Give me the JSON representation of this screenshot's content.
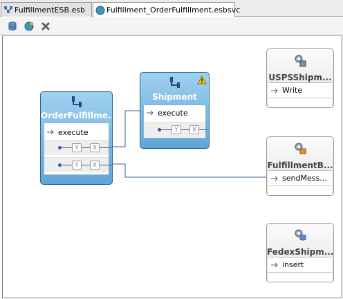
{
  "tabs": [
    {
      "label": "FulfillmentESB.esb",
      "icon": "esb-project-icon",
      "active": false
    },
    {
      "label": "Fulfillment_OrderFulfillment.esbsvc",
      "icon": "globe-icon",
      "active": true
    }
  ],
  "toolbar": {
    "buttons": [
      {
        "icon": "database-icon"
      },
      {
        "icon": "globe-icon"
      },
      {
        "icon": "delete-x-icon"
      }
    ]
  },
  "routers": [
    {
      "title": "OrderFulfillme...",
      "operation": "execute"
    },
    {
      "title": "Shipment",
      "operation": "execute",
      "warning": true
    }
  ],
  "adapters": [
    {
      "title": "USPSShipm...",
      "operation": "Write",
      "icon": "file-adapter-icon"
    },
    {
      "title": "FulfillmentB...",
      "operation": "sendMess...",
      "icon": "jms-adapter-icon"
    },
    {
      "title": "FedexShipm...",
      "operation": "insert",
      "icon": "db-adapter-icon"
    }
  ],
  "filter_label": "Y",
  "transform_label": "X",
  "colors": {
    "router_top": "#9fd0f0",
    "router_bottom": "#5fa6d6",
    "wire": "#35609a"
  }
}
